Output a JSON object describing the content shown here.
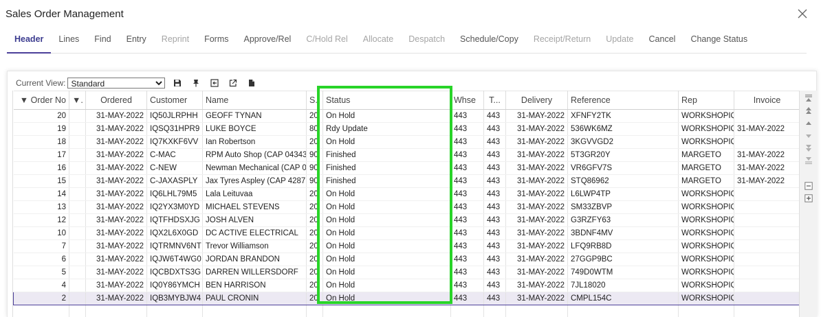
{
  "window": {
    "title": "Sales Order Management",
    "close_icon": "close-icon"
  },
  "menu": [
    {
      "label": "Header",
      "state": "active"
    },
    {
      "label": "Lines",
      "state": "enabled"
    },
    {
      "label": "Find",
      "state": "enabled"
    },
    {
      "label": "Entry",
      "state": "enabled"
    },
    {
      "label": "Reprint",
      "state": "disabled"
    },
    {
      "label": "Forms",
      "state": "enabled"
    },
    {
      "label": "Approve/Rel",
      "state": "enabled"
    },
    {
      "label": "C/Hold Rel",
      "state": "disabled"
    },
    {
      "label": "Allocate",
      "state": "disabled"
    },
    {
      "label": "Despatch",
      "state": "disabled"
    },
    {
      "label": "Schedule/Copy",
      "state": "enabled"
    },
    {
      "label": "Receipt/Return",
      "state": "disabled"
    },
    {
      "label": "Update",
      "state": "disabled"
    },
    {
      "label": "Cancel",
      "state": "enabled"
    },
    {
      "label": "Change Status",
      "state": "enabled"
    }
  ],
  "toolbar": {
    "view_label": "Current View:",
    "view_value": "Standard",
    "icons": [
      "save-icon",
      "pin-icon",
      "export-icon",
      "open-external-icon",
      "document-icon"
    ]
  },
  "grid": {
    "columns": [
      "▼ Order No",
      "▼.",
      "Ordered",
      "Customer",
      "Name",
      "S.",
      "Status",
      "Whse",
      "T...",
      "Delivery",
      "Reference",
      "Rep",
      "Invoice"
    ],
    "rows": [
      [
        "20",
        "",
        "31-MAY-2022",
        "IQ50JLRPHH",
        "GEOFF TYNAN",
        "20",
        "On Hold",
        "443",
        "443",
        "31-MAY-2022",
        "XFNFY2TK",
        "WORKSHOPIQ",
        ""
      ],
      [
        "19",
        "",
        "31-MAY-2022",
        "IQSQ31HPR9",
        "LUKE BOYCE",
        "80",
        "Rdy Update",
        "443",
        "443",
        "31-MAY-2022",
        "536WK6MZ",
        "WORKSHOPIQ",
        "31-MAY-2022"
      ],
      [
        "18",
        "",
        "31-MAY-2022",
        "IQ7KXKF6VV",
        "Ian Robertson",
        "20",
        "On Hold",
        "443",
        "443",
        "31-MAY-2022",
        "3KGVVGD2",
        "WORKSHOPIQ",
        ""
      ],
      [
        "17",
        "",
        "31-MAY-2022",
        "C-MAC",
        "RPM Auto Shop (CAP 04343",
        "90",
        "Finished",
        "443",
        "443",
        "31-MAY-2022",
        "5T3GR20Y",
        "MARGETO",
        "31-MAY-2022"
      ],
      [
        "16",
        "",
        "31-MAY-2022",
        "C-NEW",
        "Newman Mechanical (CAP 0",
        "90",
        "Finished",
        "443",
        "443",
        "31-MAY-2022",
        "VR6GFV7S",
        "MARGETO",
        "31-MAY-2022"
      ],
      [
        "15",
        "",
        "31-MAY-2022",
        "C-JAXASPLY",
        "Jax Tyres Aspley (CAP 4287",
        "90",
        "Finished",
        "443",
        "443",
        "31-MAY-2022",
        "STQ86962",
        "MARGETO",
        "31-MAY-2022"
      ],
      [
        "14",
        "",
        "31-MAY-2022",
        "IQ6LHL79M5",
        "Lala Leituvaa",
        "20",
        "On Hold",
        "443",
        "443",
        "31-MAY-2022",
        "L6LWP4TP",
        "WORKSHOPIQ",
        ""
      ],
      [
        "13",
        "",
        "31-MAY-2022",
        "IQ2YX3M0YD",
        "MICHAEL STEVENS",
        "20",
        "On Hold",
        "443",
        "443",
        "31-MAY-2022",
        "SM33ZBVP",
        "WORKSHOPIQ",
        ""
      ],
      [
        "12",
        "",
        "31-MAY-2022",
        "IQTFHDSXJG",
        "JOSH ALVEN",
        "20",
        "On Hold",
        "443",
        "443",
        "31-MAY-2022",
        "G3RZFY63",
        "WORKSHOPIQ",
        ""
      ],
      [
        "10",
        "",
        "31-MAY-2022",
        "IQX2L6X0GD",
        "DC ACTIVE ELECTRICAL",
        "20",
        "On Hold",
        "443",
        "443",
        "31-MAY-2022",
        "3BDNF4MV",
        "WORKSHOPIQ",
        ""
      ],
      [
        "7",
        "",
        "31-MAY-2022",
        "IQTRMNV6NT",
        "Trevor Williamson",
        "20",
        "On Hold",
        "443",
        "443",
        "31-MAY-2022",
        "LFQ9RB8D",
        "WORKSHOPIQ",
        ""
      ],
      [
        "6",
        "",
        "31-MAY-2022",
        "IQJW6T4WG0",
        "JORDAN  BRANDON",
        "20",
        "On Hold",
        "443",
        "443",
        "31-MAY-2022",
        "27GGP9BC",
        "WORKSHOPIQ",
        ""
      ],
      [
        "5",
        "",
        "31-MAY-2022",
        "IQCBDXTS3G",
        "DARREN  WILLERSDORF",
        "20",
        "On Hold",
        "443",
        "443",
        "31-MAY-2022",
        "749D0WTM",
        "WORKSHOPIQ",
        ""
      ],
      [
        "4",
        "",
        "31-MAY-2022",
        "IQ0Y86YMCH",
        "BEN  HARRISON",
        "20",
        "On Hold",
        "443",
        "443",
        "31-MAY-2022",
        "7JL18020",
        "WORKSHOPIQ",
        ""
      ],
      [
        "2",
        "",
        "31-MAY-2022",
        "IQB3MYBJW4",
        "PAUL CRONIN",
        "20",
        "On Hold",
        "443",
        "443",
        "31-MAY-2022",
        "CMPL154C",
        "WORKSHOPIQ",
        ""
      ]
    ],
    "selected_row": 14
  },
  "highlight_color": "#28d428",
  "accent_color": "#4b3f99",
  "scroll_icons": [
    "scroll-top-icon",
    "page-up-icon",
    "line-up-icon",
    "line-down-icon",
    "page-down-icon",
    "scroll-bottom-icon",
    "collapse-icon",
    "expand-icon"
  ]
}
